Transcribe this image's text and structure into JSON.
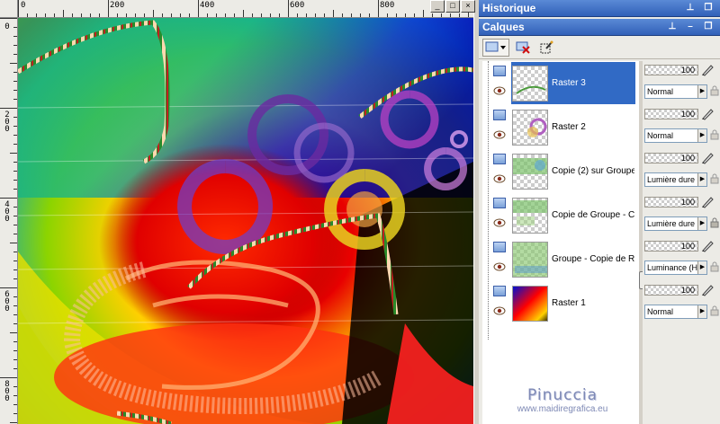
{
  "ruler": {
    "horizontal_labels": [
      "0",
      "200",
      "400",
      "600",
      "800"
    ],
    "vertical_labels": [
      "0",
      "200",
      "400",
      "600",
      "800"
    ]
  },
  "window_buttons": [
    "_",
    "□",
    "×"
  ],
  "panels": {
    "history": {
      "title": "Historique"
    },
    "layers": {
      "title": "Calques",
      "toolbar": [
        "new-layer-icon",
        "delete-layer-icon",
        "edit-selection-icon"
      ],
      "rows": [
        {
          "name": "Raster 3",
          "opacity": "100",
          "blend": "Normal",
          "selected": true
        },
        {
          "name": "Raster 2",
          "opacity": "100",
          "blend": "Normal",
          "selected": false
        },
        {
          "name": "Copie (2) sur Groupe",
          "opacity": "100",
          "blend": "Lumière dure",
          "selected": false
        },
        {
          "name": "Copie de Groupe - Co",
          "opacity": "100",
          "blend": "Lumière dure",
          "selected": false
        },
        {
          "name": "Groupe - Copie de Ra",
          "opacity": "100",
          "blend": "Luminance (H)",
          "selected": false
        },
        {
          "name": "Raster 1",
          "opacity": "100",
          "blend": "Normal",
          "selected": false
        }
      ]
    }
  },
  "watermark": {
    "name": "Pinuccia",
    "url": "www.maidiregrafica.eu"
  },
  "colors": {
    "title_bar": "#3160b8",
    "selection": "#316ac5",
    "panel_bg": "#ecebe6"
  }
}
